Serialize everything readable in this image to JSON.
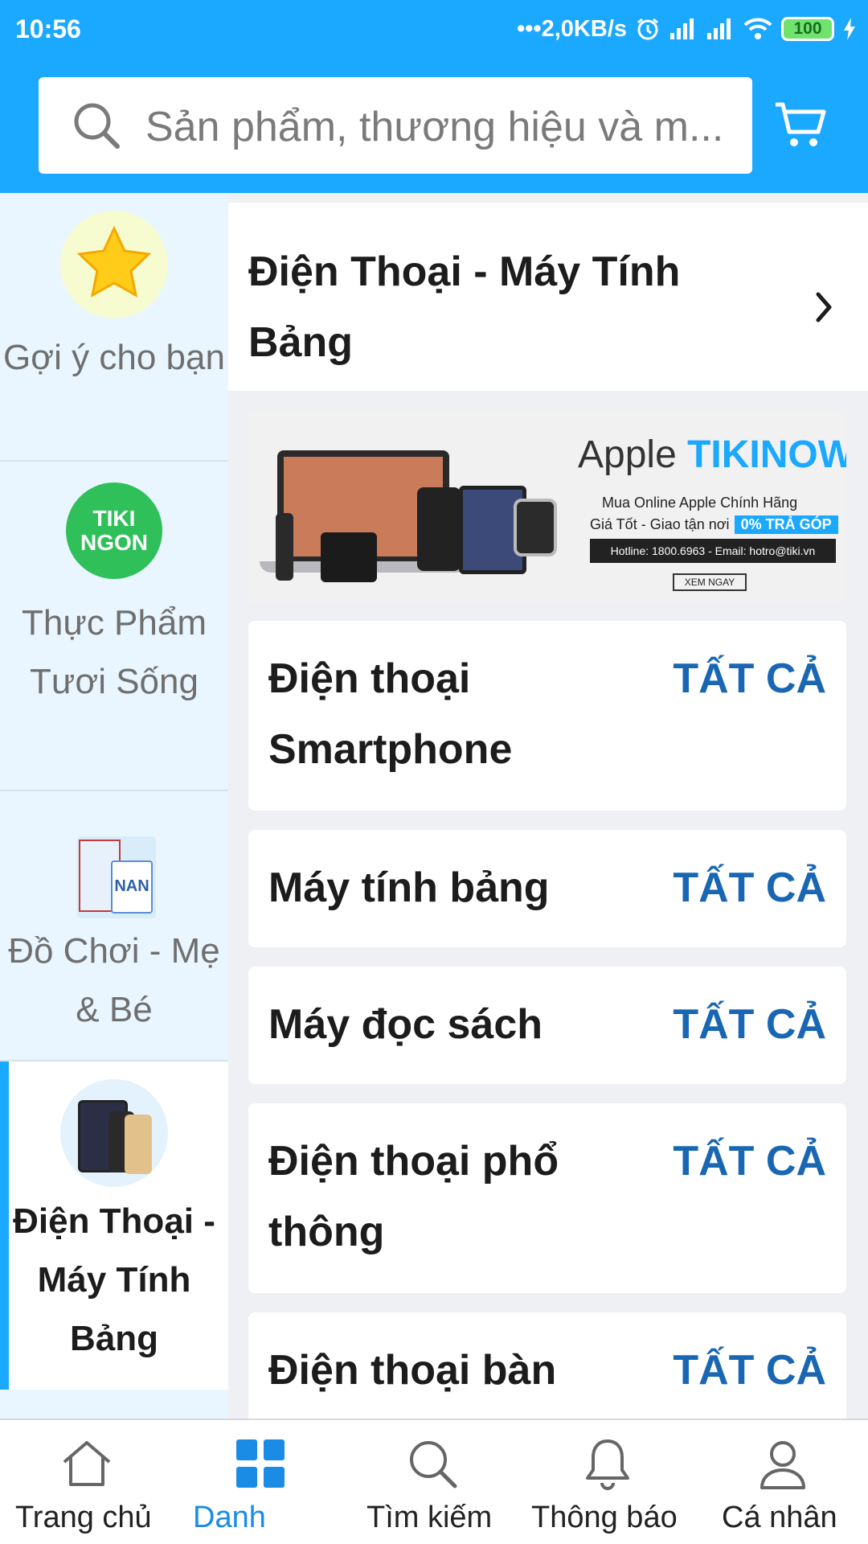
{
  "status_bar": {
    "time": "10:56",
    "net_speed": "•••2,0KB/s",
    "battery": "100"
  },
  "search": {
    "placeholder": "Sản phẩm, thương hiệu và m..."
  },
  "sidebar": {
    "items": [
      {
        "label": "Gợi ý cho bạn",
        "icon": "star-icon"
      },
      {
        "label": "Thực Phẩm Tươi Sống",
        "icon": "tiki-ngon-logo",
        "logo_text": "TIKI NGON"
      },
      {
        "label": "Đồ Chơi - Mẹ & Bé",
        "icon": "baby-products-thumbnail",
        "logo_text": "NAN"
      },
      {
        "label": "Điện Thoại - Máy Tính Bảng",
        "icon": "phones-thumbnail",
        "active": true
      }
    ]
  },
  "category": {
    "title": "Điện Thoại - Máy Tính Bảng"
  },
  "banner": {
    "brand": "Apple",
    "brand_accent": "TIKINOW",
    "line1": "Mua Online Apple Chính Hãng",
    "line2": "Giá Tốt - Giao tận nơi",
    "tag": "0% TRẢ GÓP",
    "contact": "Hotline: 1800.6963  -  Email: hotro@tiki.vn",
    "cta": "XEM NGAY"
  },
  "subcategories": [
    {
      "name": "Điện thoại Smartphone",
      "action": "TẤT CẢ"
    },
    {
      "name": "Máy tính bảng",
      "action": "TẤT CẢ"
    },
    {
      "name": "Máy đọc sách",
      "action": "TẤT CẢ"
    },
    {
      "name": "Điện thoại phổ thông",
      "action": "TẤT CẢ"
    },
    {
      "name": "Điện thoại bàn",
      "action": "TẤT CẢ"
    }
  ],
  "bottom_nav": {
    "items": [
      {
        "label": "Trang chủ",
        "icon": "home-icon"
      },
      {
        "label": "Danh",
        "icon": "grid-icon",
        "active": true
      },
      {
        "label": "Tìm kiếm",
        "icon": "search-icon"
      },
      {
        "label": "Thông báo",
        "icon": "bell-icon"
      },
      {
        "label": "Cá nhân",
        "icon": "user-icon"
      }
    ]
  },
  "colors": {
    "brand_blue": "#1ba8ff",
    "link_blue": "#1967b3",
    "sidebar_bg": "#e9f6ff"
  }
}
